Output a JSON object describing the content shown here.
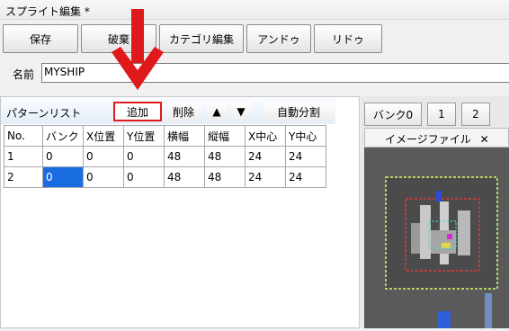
{
  "window": {
    "title": "スプライト編集 *"
  },
  "toolbar": {
    "save": "保存",
    "discard": "破棄",
    "category_edit": "カテゴリ編集",
    "undo": "アンドゥ",
    "redo": "リドゥ"
  },
  "name_field": {
    "label": "名前",
    "value": "MYSHIP"
  },
  "pattern_list": {
    "title": "パターンリスト",
    "add": "追加",
    "delete": "削除",
    "up": "▲",
    "down": "▼",
    "auto_split": "自動分割",
    "columns": [
      "No.",
      "バンク",
      "X位置",
      "Y位置",
      "横幅",
      "縦幅",
      "X中心",
      "Y中心"
    ],
    "rows": [
      [
        "1",
        "0",
        "0",
        "0",
        "48",
        "48",
        "24",
        "24"
      ],
      [
        "2",
        "0",
        "0",
        "0",
        "48",
        "48",
        "24",
        "24"
      ]
    ]
  },
  "banks": {
    "tabs": [
      "バンク0",
      "1",
      "2"
    ]
  },
  "image_file_tab": {
    "label": "イメージファイル",
    "close": "✕"
  },
  "colors": {
    "highlight": "#e0191a",
    "selection": "#1a6de0"
  }
}
